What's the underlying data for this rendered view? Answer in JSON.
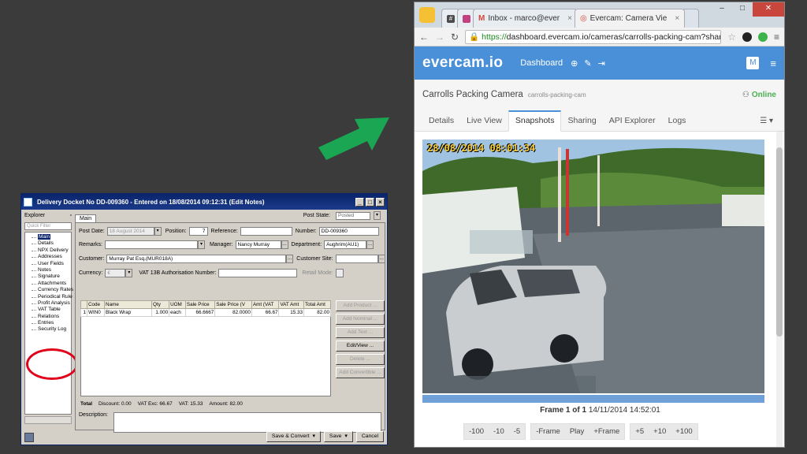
{
  "desktop": {
    "title": "Delivery Docket No DD-009360 - Entered on 18/08/2014 09:12:31 (Edit Notes)",
    "explorer": {
      "header": "Explorer",
      "filter_placeholder": "Quick Filter",
      "items": [
        "Main",
        "Details",
        "NPX Delivery",
        "Addresses",
        "User Fields",
        "Notes",
        "Signature",
        "Attachments",
        "Currency Rates",
        "Periodical Rule",
        "Profit Analysis",
        "VAT Table",
        "Relations",
        "Entries",
        "Security Log"
      ]
    },
    "tab_main": "Main",
    "post_state_label": "Post State:",
    "post_state_value": "Posted",
    "form": {
      "post_date_label": "Post Date:",
      "post_date_value": "18 August 2014",
      "position_label": "Position:",
      "position_value": "7",
      "reference_label": "Reference:",
      "reference_value": "",
      "number_label": "Number:",
      "number_value": "DD-009360",
      "remarks_label": "Remarks:",
      "manager_label": "Manager:",
      "manager_value": "Nancy Murray",
      "department_label": "Department:",
      "department_value": "Aughrim(AU1)",
      "customer_label": "Customer:",
      "customer_value": "Murray Pat Esq.(MUR018A)",
      "customer_site_label": "Customer Site:",
      "currency_label": "Currency:",
      "currency_value": "€",
      "vat_auth_label": "VAT 13B Authorisation Number:",
      "retail_mode_label": "Retail Mode:"
    },
    "lines": {
      "headers": [
        "",
        "Code",
        "Name",
        "Qty",
        "UOM",
        "Sale Price",
        "Sale Price (V",
        "Amt (VAT",
        "VAT Amt",
        "Total Amt"
      ],
      "rows": [
        [
          "1",
          "WIN0",
          "Black Wrap",
          "1.000",
          "each",
          "66.6667",
          "82.0000",
          "66.67",
          "15.33",
          "82.00"
        ]
      ]
    },
    "side_buttons": [
      "Add Product ...",
      "Add Nominal ...",
      "Add Text ...",
      "Edit/View ...",
      "Delete ...",
      "Add Convertible ..."
    ],
    "totals": {
      "label": "Total",
      "discount": "Discount: 0.00",
      "vat_exc": "VAT Exc: 66.67",
      "vat": "VAT: 15.33",
      "amount": "Amount: 82.00"
    },
    "description_label": "Description:",
    "buttons": {
      "save_convert": "Save & Convert",
      "save": "Save",
      "cancel": "Cancel"
    }
  },
  "browser": {
    "tabs": [
      {
        "label": "#",
        "icon": "slack-icon",
        "color": "#4a4a4a"
      },
      {
        "label": "",
        "icon": "trello-icon",
        "color": "#c04080"
      },
      {
        "label": "Inbox - marco@ever",
        "icon": "gmail-icon",
        "color": "#d44638"
      },
      {
        "label": "Evercam: Camera Vie",
        "icon": "evercam-icon",
        "color": "#d44638"
      }
    ],
    "url_scheme": "https://",
    "url_rest": "dashboard.evercam.io/cameras/carrolls-packing-cam?share=",
    "app": {
      "logo": "evercam.io",
      "dashboard": "Dashboard",
      "user_initial": "M",
      "camera_name": "Carrolls Packing Camera",
      "camera_id": "carrolls-packing-cam",
      "status": "Online",
      "tabs": [
        "Details",
        "Live View",
        "Snapshots",
        "Sharing",
        "API Explorer",
        "Logs"
      ],
      "active_tab": "Snapshots",
      "timestamp": "28/08/2014 08:01:34",
      "frame_label": "Frame 1 of 1",
      "frame_date": "14/11/2014 14:52:01",
      "frame_buttons_back": [
        "-100",
        "-10",
        "-5"
      ],
      "frame_buttons_mid": [
        "-Frame",
        "Play",
        "+Frame"
      ],
      "frame_buttons_fwd": [
        "+5",
        "+10",
        "+100"
      ]
    }
  },
  "colors": {
    "evercam_blue": "#4a90d9",
    "arrow_green": "#1aa652",
    "circle_red": "#e0001a"
  }
}
